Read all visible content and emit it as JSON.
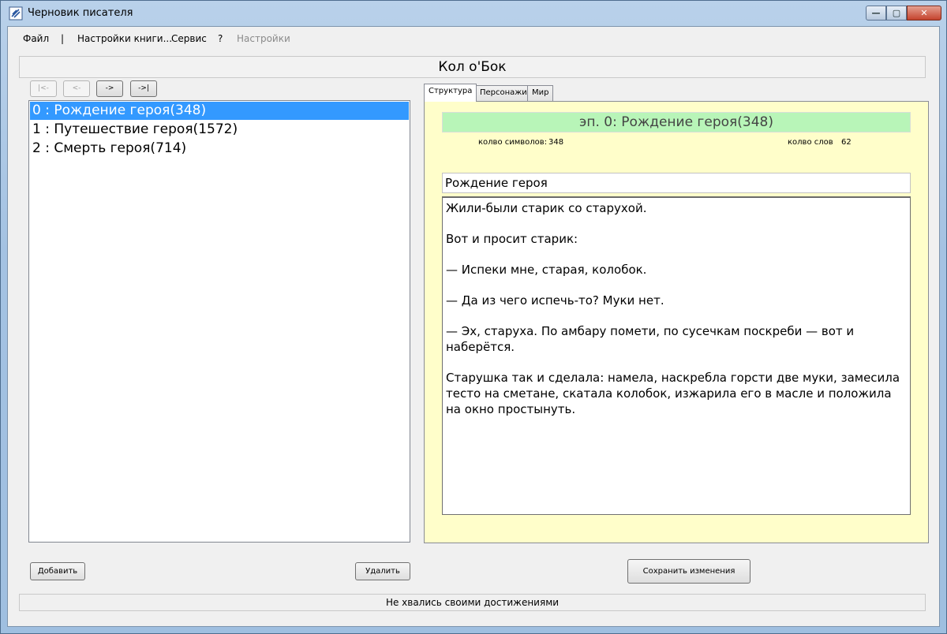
{
  "window": {
    "title": "Черновик писателя",
    "buttons": {
      "minimize": "—",
      "maximize": "▢",
      "close": "✕"
    }
  },
  "menu": {
    "file": "Файл",
    "separator": "|",
    "book_settings": "Настройки книги...",
    "service": "Сервис",
    "help": "?",
    "settings": "Настройки"
  },
  "book": {
    "title": "Кол о'Бок"
  },
  "nav": {
    "first": "|<-",
    "prev": "<-",
    "next": "->",
    "last": "->|"
  },
  "episodes": [
    {
      "label": "0 : Рождение героя(348)",
      "selected": true
    },
    {
      "label": "1 : Путешествие героя(1572)",
      "selected": false
    },
    {
      "label": "2 : Смерть героя(714)",
      "selected": false
    }
  ],
  "tabs": {
    "structure": "Структура",
    "characters": "Персонажи",
    "world": "Мир",
    "active": "structure"
  },
  "episode": {
    "header": "эп. 0: Рождение героя(348)",
    "chars_label": "колво символов:",
    "chars_value": "348",
    "words_label": "колво слов",
    "words_value": "62",
    "name": "Рождение героя",
    "text": [
      "Жили-были старик со старухой.",
      "Вот и просит старик:",
      "— Испеки мне, старая, колобок.",
      "— Да из чего испечь-то? Муки нет.",
      "— Эх, старуха. По амбару помети, по сусечкам поскреби — вот и наберётся.",
      "Старушка так и сделала: намела, наскребла горсти две муки, замесила тесто на сметане, скатала колобок, изжарила его в масле и положила на окно простынуть."
    ]
  },
  "buttons": {
    "add": "Добавить",
    "delete": "Удалить",
    "save": "Сохранить изменения"
  },
  "status": "Не хвались своими достижениями",
  "colors": {
    "selection": "#3399ff",
    "panel_bg": "#fffeca",
    "header_bg": "#b8f5b8"
  }
}
